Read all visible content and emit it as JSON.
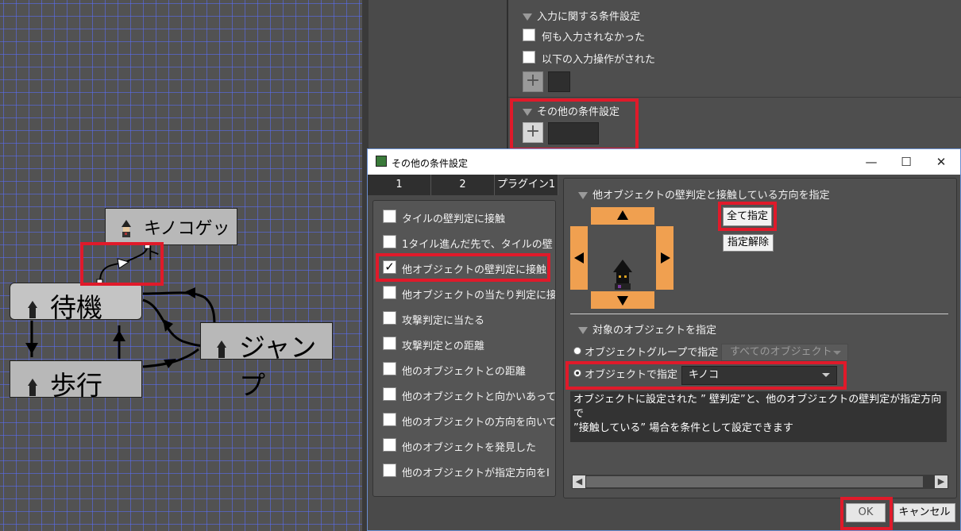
{
  "graph": {
    "nodes": {
      "kinoko": "キノコゲット",
      "taiki": "待機",
      "jump": "ジャンプ",
      "hokou": "歩行"
    }
  },
  "properties": {
    "input_section": "入力に関する条件設定",
    "cb_no_input": "何も入力されなかった",
    "cb_input_done": "以下の入力操作がされた",
    "other_section": "その他の条件設定"
  },
  "dialog": {
    "title": "その他の条件設定",
    "controls": {
      "minimize": "—",
      "maximize": "☐",
      "close": "✕"
    },
    "tabs": [
      "1",
      "2",
      "プラグイン1"
    ],
    "conditions": [
      {
        "label": "タイルの壁判定に接触",
        "checked": false
      },
      {
        "label": "1タイル進んだ先で、タイルの壁",
        "checked": false
      },
      {
        "label": "他オブジェクトの壁判定に接触",
        "checked": true
      },
      {
        "label": "他オブジェクトの当たり判定に接",
        "checked": false
      },
      {
        "label": "攻撃判定に当たる",
        "checked": false
      },
      {
        "label": "攻撃判定との距離",
        "checked": false
      },
      {
        "label": "他のオブジェクトとの距離",
        "checked": false
      },
      {
        "label": "他のオブジェクトと向かいあって",
        "checked": false
      },
      {
        "label": "他のオブジェクトの方向を向いて",
        "checked": false
      },
      {
        "label": "他のオブジェクトを発見した",
        "checked": false
      },
      {
        "label": "他のオブジェクトが指定方向をI",
        "checked": false
      }
    ],
    "direction_section": "他オブジェクトの壁判定と接触している方向を指定",
    "select_all": "全て指定",
    "deselect": "指定解除",
    "target_section": "対象のオブジェクトを指定",
    "by_group_label": "オブジェクトグループで指定",
    "group_value": "すべてのオブジェクト",
    "by_object_label": "オブジェクトで指定",
    "object_value": "キノコ",
    "description": "オブジェクトに設定された ” 壁判定”と、他のオブジェクトの壁判定が指定方向で\n”接触している” 場合を条件として設定できます",
    "ok": "OK",
    "cancel": "キャンセル"
  }
}
